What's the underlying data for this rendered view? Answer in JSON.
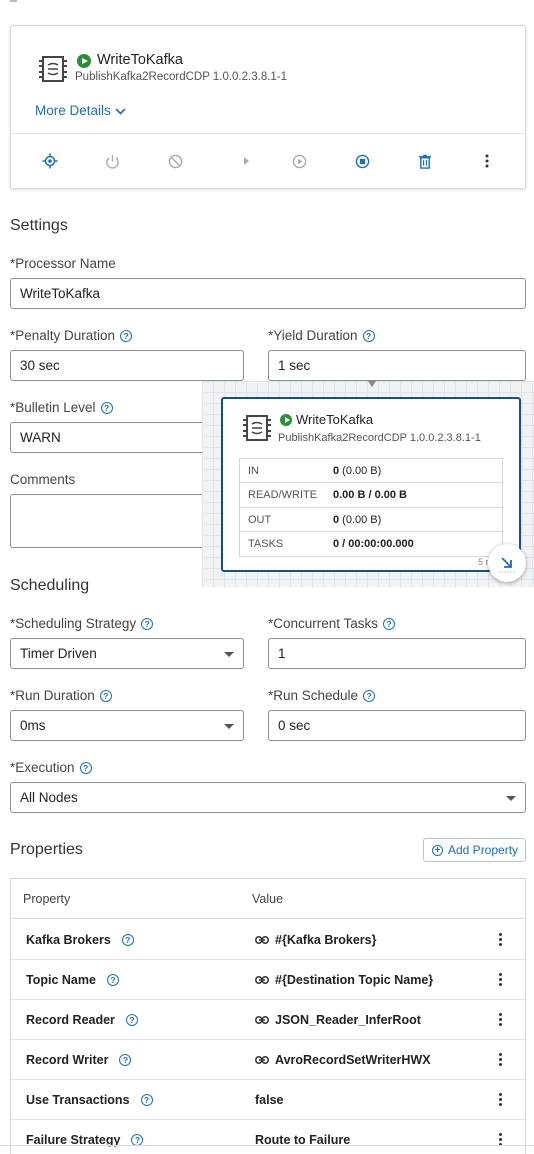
{
  "processor": {
    "name": "WriteToKafka",
    "type": "PublishKafka2RecordCDP 1.0.0.2.3.8.1-1",
    "more_details": "More Details"
  },
  "toolbar": {
    "icons": [
      "locate-icon",
      "power-icon",
      "disable-icon",
      "step-icon",
      "start-icon",
      "stop-icon",
      "delete-icon",
      "more-icon"
    ]
  },
  "settings": {
    "title": "Settings",
    "processor_name_label": "*Processor Name",
    "processor_name_value": "WriteToKafka",
    "penalty_label": "*Penalty Duration",
    "penalty_value": "30 sec",
    "yield_label": "*Yield Duration",
    "yield_value": "1 sec",
    "bulletin_label": "*Bulletin Level",
    "bulletin_value": "WARN",
    "comments_label": "Comments"
  },
  "scheduling": {
    "title": "Scheduling",
    "strategy_label": "*Scheduling Strategy",
    "strategy_value": "Timer Driven",
    "concurrent_label": "*Concurrent Tasks",
    "concurrent_value": "1",
    "run_duration_label": "*Run Duration",
    "run_duration_value": "0ms",
    "run_schedule_label": "*Run Schedule",
    "run_schedule_value": "0 sec",
    "execution_label": "*Execution",
    "execution_value": "All Nodes"
  },
  "properties": {
    "title": "Properties",
    "add_label": "Add Property",
    "col_property": "Property",
    "col_value": "Value",
    "rows": [
      {
        "name": "Kafka Brokers",
        "value": "#{Kafka Brokers}",
        "link": true
      },
      {
        "name": "Topic Name",
        "value": "#{Destination Topic Name}",
        "link": true
      },
      {
        "name": "Record Reader",
        "value": "JSON_Reader_InferRoot",
        "link": true
      },
      {
        "name": "Record Writer",
        "value": "AvroRecordSetWriterHWX",
        "link": true
      },
      {
        "name": "Use Transactions",
        "value": "false",
        "link": false
      },
      {
        "name": "Failure Strategy",
        "value": "Route to Failure",
        "link": false
      }
    ]
  },
  "overlay": {
    "name": "WriteToKafka",
    "type": "PublishKafka2RecordCDP 1.0.0.2.3.8.1-1",
    "stats": [
      {
        "key": "IN",
        "bold": "0",
        "rest": " (0.00 B)"
      },
      {
        "key": "READ/WRITE",
        "bold": "0.00 B / 0.00 B",
        "rest": ""
      },
      {
        "key": "OUT",
        "bold": "0",
        "rest": " (0.00 B)"
      },
      {
        "key": "TASKS",
        "bold": "0 / 00:00:00.000",
        "rest": ""
      }
    ],
    "corner_text": "5 r"
  },
  "colors": {
    "accent": "#1f6fb2",
    "running": "#2e8b3a",
    "selected_border": "#1d4f7e"
  }
}
